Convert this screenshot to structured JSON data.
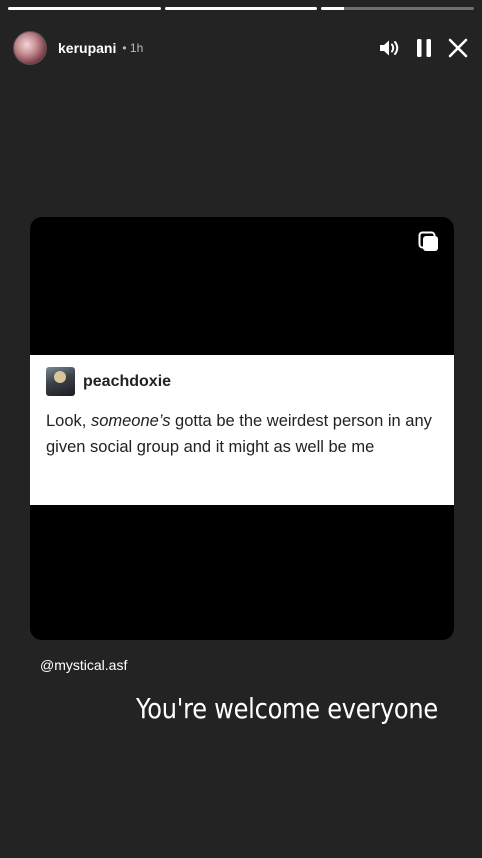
{
  "progress": {
    "segments": [
      {
        "fill": 1.0
      },
      {
        "fill": 1.0
      },
      {
        "fill": 0.15
      }
    ]
  },
  "header": {
    "username": "kerupani",
    "time": "• 1h",
    "icons": [
      "volume-icon",
      "pause-icon",
      "close-icon"
    ]
  },
  "post": {
    "username": "peachdoxie",
    "text_before": "Look, ",
    "text_italic": "someone’s",
    "text_after": " gotta be the weirdest person in any given social group and it might as well be me",
    "multi_icon": "carousel-icon"
  },
  "mention": "@mystical.asf",
  "caption": "You're welcome everyone",
  "colors": {
    "background": "#232323",
    "media": "#000000",
    "card": "#ffffff",
    "text": "#ffffff"
  }
}
